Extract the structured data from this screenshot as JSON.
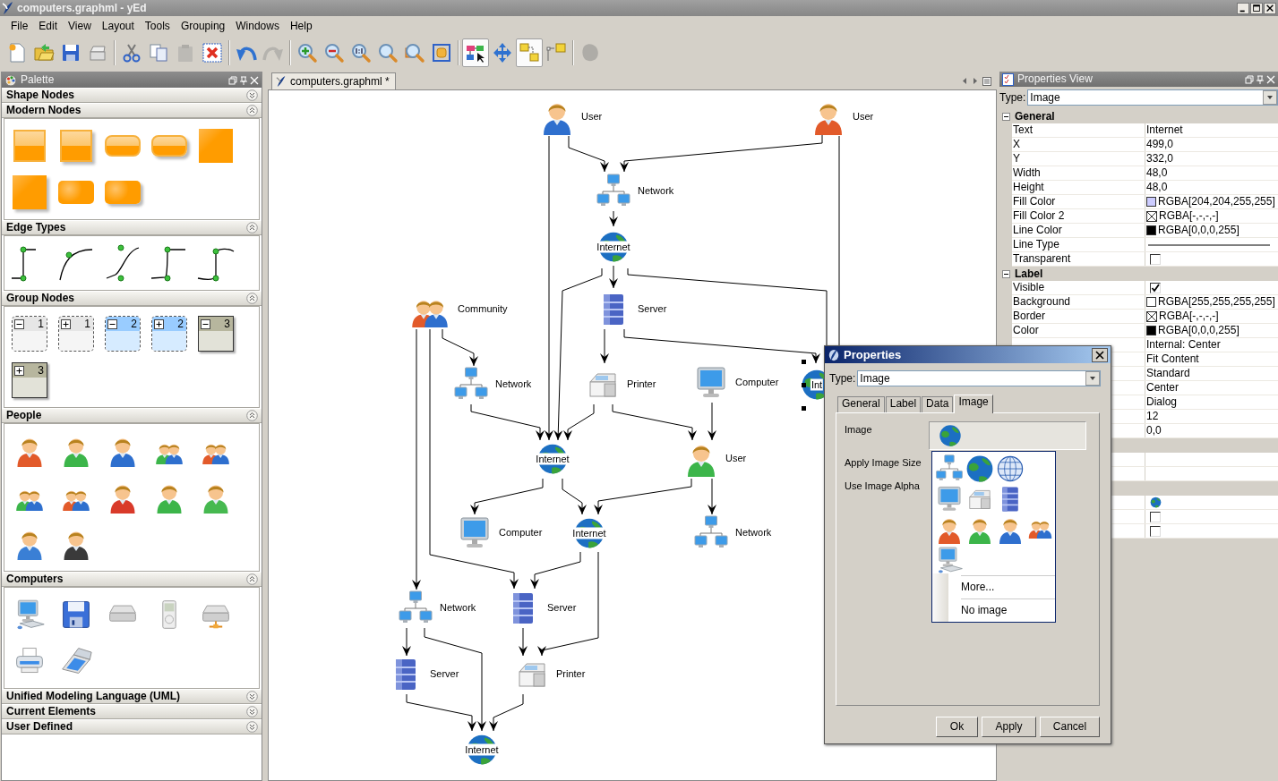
{
  "window": {
    "title": "computers.graphml - yEd"
  },
  "menu": [
    "File",
    "Edit",
    "View",
    "Layout",
    "Tools",
    "Grouping",
    "Windows",
    "Help"
  ],
  "toolbar": [
    {
      "kind": "new",
      "selected": false,
      "disabled": false
    },
    {
      "kind": "open",
      "selected": false,
      "disabled": false
    },
    {
      "kind": "save",
      "selected": false,
      "disabled": false
    },
    {
      "kind": "print",
      "selected": false,
      "disabled": false
    },
    {
      "kind": "separator"
    },
    {
      "kind": "cut",
      "selected": false,
      "disabled": false
    },
    {
      "kind": "copy",
      "selected": false,
      "disabled": false
    },
    {
      "kind": "paste",
      "selected": false,
      "disabled": true
    },
    {
      "kind": "delete",
      "selected": false,
      "disabled": false
    },
    {
      "kind": "separator"
    },
    {
      "kind": "undo",
      "selected": false,
      "disabled": false
    },
    {
      "kind": "redo",
      "selected": false,
      "disabled": true
    },
    {
      "kind": "separator"
    },
    {
      "kind": "zoom-in",
      "selected": false,
      "disabled": false
    },
    {
      "kind": "zoom-out",
      "selected": false,
      "disabled": false
    },
    {
      "kind": "actual-size",
      "selected": false,
      "disabled": false
    },
    {
      "kind": "zoom",
      "selected": false,
      "disabled": false
    },
    {
      "kind": "zoom-area",
      "selected": false,
      "disabled": false
    },
    {
      "kind": "fit",
      "selected": false,
      "disabled": false
    },
    {
      "kind": "separator"
    },
    {
      "kind": "edit-mode",
      "selected": true,
      "disabled": false
    },
    {
      "kind": "navigate",
      "selected": false,
      "disabled": false
    },
    {
      "kind": "layout",
      "selected": true,
      "disabled": false
    },
    {
      "kind": "snap",
      "selected": false,
      "disabled": false
    },
    {
      "kind": "separator"
    },
    {
      "kind": "plugin",
      "selected": false,
      "disabled": true
    }
  ],
  "palette": {
    "title": "Palette",
    "sections": [
      {
        "title": "Shape Nodes",
        "expanded": false
      },
      {
        "title": "Modern Nodes",
        "expanded": true,
        "items": [
          {
            "kind": "glass-box"
          },
          {
            "kind": "glass-box-shadow"
          },
          {
            "kind": "glass-pill"
          },
          {
            "kind": "glass-pill-shadow"
          },
          {
            "kind": "square"
          },
          {
            "kind": "square-shadow"
          },
          {
            "kind": "rounded"
          },
          {
            "kind": "rounded-shine"
          }
        ]
      },
      {
        "title": "Edge Types",
        "expanded": true,
        "items": [
          {
            "kind": "edge-orthogonal"
          },
          {
            "kind": "edge-arc"
          },
          {
            "kind": "edge-spline"
          },
          {
            "kind": "edge-bend"
          },
          {
            "kind": "edge-curve"
          }
        ]
      },
      {
        "title": "Group Nodes",
        "expanded": true,
        "items": [
          {
            "kind": "group",
            "expanded": true,
            "count": "1",
            "color": "#e6e6e6"
          },
          {
            "kind": "group",
            "expanded": false,
            "count": "1",
            "color": "#e6e6e6"
          },
          {
            "kind": "group",
            "expanded": true,
            "count": "2",
            "color": "#99ccff"
          },
          {
            "kind": "group",
            "expanded": false,
            "count": "2",
            "color": "#99ccff"
          },
          {
            "kind": "table-group",
            "expanded": true,
            "count": "3",
            "color": "#b7b69e"
          },
          {
            "kind": "table-group",
            "expanded": false,
            "count": "3",
            "color": "#b7b69e"
          }
        ]
      },
      {
        "title": "People",
        "expanded": true,
        "items": [
          {
            "kind": "person",
            "color": "#e25a2a"
          },
          {
            "kind": "person",
            "color": "#3cb54a"
          },
          {
            "kind": "person",
            "color": "#2e6fce"
          },
          {
            "kind": "mixed-pair"
          },
          {
            "kind": "pair"
          },
          {
            "kind": "mixed-pair"
          },
          {
            "kind": "pair"
          },
          {
            "kind": "person",
            "color": "#d93a2a"
          },
          {
            "kind": "person",
            "color": "#3cb54a"
          },
          {
            "kind": "person",
            "color": "#46b950"
          },
          {
            "kind": "person",
            "color": "#3a7fd5"
          },
          {
            "kind": "person",
            "color": "#3a3a3a"
          }
        ]
      },
      {
        "title": "Computers",
        "expanded": true,
        "items": [
          {
            "kind": "computer"
          },
          {
            "kind": "floppy"
          },
          {
            "kind": "drive"
          },
          {
            "kind": "media-player"
          },
          {
            "kind": "network-drive"
          },
          {
            "kind": "desk-printer"
          },
          {
            "kind": "scanner"
          }
        ]
      },
      {
        "title": "Unified Modeling Language (UML)",
        "expanded": false
      },
      {
        "title": "Current Elements",
        "expanded": false
      },
      {
        "title": "User Defined",
        "expanded": false
      }
    ]
  },
  "document_tab": {
    "title": "computers.graphml *"
  },
  "diagram": {
    "nodes": [
      {
        "kind": "person",
        "label": "User",
        "color": "#2e6fce",
        "selected": false
      },
      {
        "kind": "person",
        "label": "User",
        "color": "#e25a2a",
        "selected": false
      },
      {
        "kind": "network",
        "label": "Network",
        "selected": false
      },
      {
        "kind": "globe",
        "label": "Internet",
        "selected": false
      },
      {
        "kind": "server",
        "label": "Server",
        "selected": false
      },
      {
        "kind": "pair",
        "label": "Community",
        "selected": false
      },
      {
        "kind": "network",
        "label": "Network",
        "selected": false
      },
      {
        "kind": "printer",
        "label": "Printer",
        "selected": false
      },
      {
        "kind": "monitor",
        "label": "Computer",
        "selected": false
      },
      {
        "kind": "globe",
        "label": "Int",
        "selected": true
      },
      {
        "kind": "globe",
        "label": "Internet",
        "selected": false
      },
      {
        "kind": "person",
        "label": "User",
        "color": "#3cb54a",
        "selected": false
      },
      {
        "kind": "monitor",
        "label": "Computer",
        "selected": false
      },
      {
        "kind": "globe",
        "label": "Internet",
        "selected": false
      },
      {
        "kind": "network",
        "label": "Network",
        "selected": false
      },
      {
        "kind": "network",
        "label": "Network",
        "selected": false
      },
      {
        "kind": "server",
        "label": "Server",
        "selected": false
      },
      {
        "kind": "server",
        "label": "Server",
        "selected": false
      },
      {
        "kind": "printer",
        "label": "Printer",
        "selected": false
      },
      {
        "kind": "globe",
        "label": "Internet",
        "selected": false
      }
    ]
  },
  "properties_view": {
    "title": "Properties View",
    "type_label": "Type:",
    "type": "Image",
    "rows": [
      {
        "kind": "group",
        "name": "General",
        "expanded": true
      },
      {
        "kind": "text",
        "name": "Text",
        "value": "Internet"
      },
      {
        "kind": "text",
        "name": "X",
        "value": "499,0"
      },
      {
        "kind": "text",
        "name": "Y",
        "value": "332,0"
      },
      {
        "kind": "text",
        "name": "Width",
        "value": "48,0"
      },
      {
        "kind": "text",
        "name": "Height",
        "value": "48,0"
      },
      {
        "kind": "color",
        "name": "Fill Color",
        "value": "RGBA[204,204,255,255]",
        "color": "#ccccff"
      },
      {
        "kind": "no-color",
        "name": "Fill Color 2",
        "value": "RGBA[-,-,-,-]"
      },
      {
        "kind": "color",
        "name": "Line Color",
        "value": "RGBA[0,0,0,255]",
        "color": "#000000"
      },
      {
        "kind": "line",
        "name": "Line Type"
      },
      {
        "kind": "checkbox",
        "name": "Transparent",
        "checked": false
      },
      {
        "kind": "group",
        "name": "Label",
        "expanded": true
      },
      {
        "kind": "checkbox",
        "name": "Visible",
        "checked": true
      },
      {
        "kind": "color",
        "name": "Background",
        "value": "RGBA[255,255,255,255]",
        "color": "#ffffff"
      },
      {
        "kind": "no-color",
        "name": "Border",
        "value": "RGBA[-,-,-,-]"
      },
      {
        "kind": "color",
        "name": "Color",
        "value": "RGBA[0,0,0,255]",
        "color": "#000000"
      },
      {
        "kind": "text",
        "value": "Internal: Center"
      },
      {
        "kind": "text",
        "value": "Fit Content"
      },
      {
        "kind": "text",
        "value": "Standard"
      },
      {
        "kind": "text",
        "value": "Center"
      },
      {
        "kind": "text",
        "value": "Dialog"
      },
      {
        "kind": "text",
        "value": "12"
      },
      {
        "kind": "text",
        "value": "0,0"
      },
      {
        "kind": "group"
      },
      {
        "kind": "text"
      },
      {
        "kind": "text"
      },
      {
        "kind": "group"
      },
      {
        "kind": "image"
      },
      {
        "kind": "checkbox",
        "checked": false
      },
      {
        "kind": "checkbox",
        "checked": false
      }
    ]
  },
  "dialog": {
    "title": "Properties",
    "type_label": "Type:",
    "type": "Image",
    "tabs": [
      {
        "label": "General",
        "selected": false
      },
      {
        "label": "Label",
        "selected": false
      },
      {
        "label": "Data",
        "selected": false
      },
      {
        "label": "Image",
        "selected": true
      }
    ],
    "fields": [
      "Image",
      "Apply Image Size",
      "Use Image Alpha"
    ],
    "image_menu": {
      "images": [
        {
          "kind": "network"
        },
        {
          "kind": "globe"
        },
        {
          "kind": "wire-globe"
        },
        {
          "kind": "monitor"
        },
        {
          "kind": "printer"
        },
        {
          "kind": "server"
        },
        {
          "kind": "person",
          "color": "#e25a2a"
        },
        {
          "kind": "person",
          "color": "#3cb54a"
        },
        {
          "kind": "person",
          "color": "#2e6fce"
        },
        {
          "kind": "pair"
        },
        {
          "kind": "computer"
        }
      ],
      "items": [
        "More...",
        "No image"
      ]
    },
    "buttons": [
      "Ok",
      "Apply",
      "Cancel"
    ]
  }
}
